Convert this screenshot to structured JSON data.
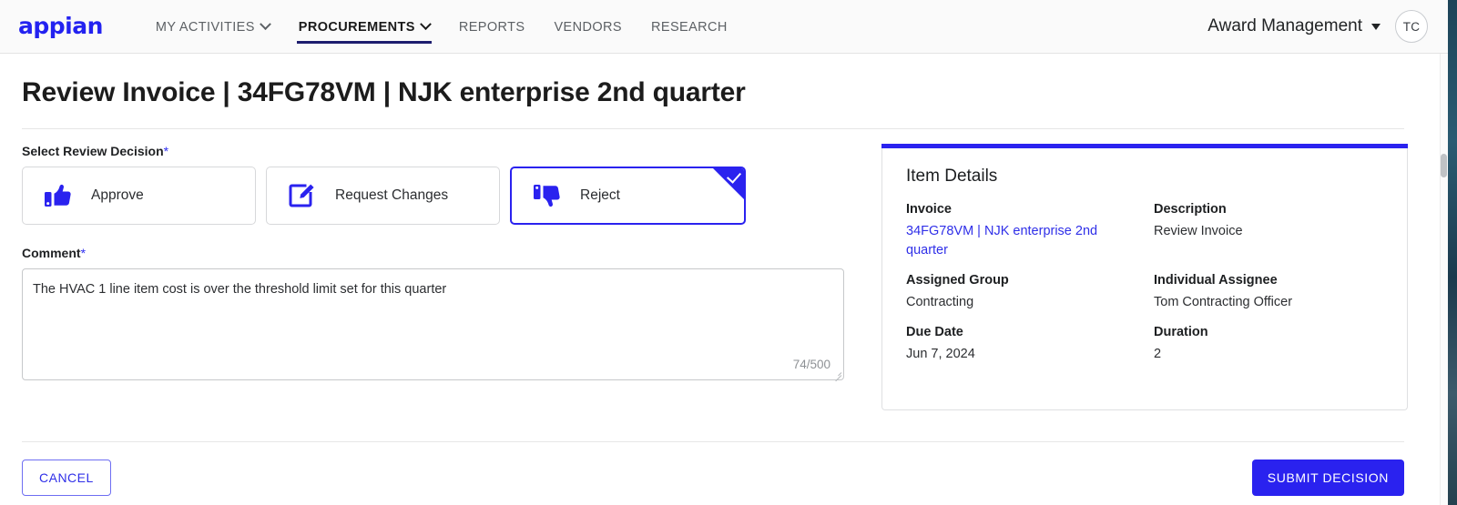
{
  "brand": {
    "logo_text": "appian",
    "logo_color": "#2322f0"
  },
  "nav": {
    "items": [
      {
        "label": "MY ACTIVITIES",
        "has_dropdown": true,
        "active": false
      },
      {
        "label": "PROCUREMENTS",
        "has_dropdown": true,
        "active": true
      },
      {
        "label": "REPORTS",
        "has_dropdown": false,
        "active": false
      },
      {
        "label": "VENDORS",
        "has_dropdown": false,
        "active": false
      },
      {
        "label": "RESEARCH",
        "has_dropdown": false,
        "active": false
      }
    ],
    "site_selector": "Award Management",
    "avatar_initials": "TC"
  },
  "page": {
    "title": "Review Invoice | 34FG78VM | NJK enterprise 2nd quarter"
  },
  "decision": {
    "label": "Select Review Decision",
    "required_marker": "*",
    "options": [
      {
        "label": "Approve",
        "icon": "thumbs-up-icon",
        "selected": false
      },
      {
        "label": "Request Changes",
        "icon": "edit-square-icon",
        "selected": false
      },
      {
        "label": "Reject",
        "icon": "thumbs-down-icon",
        "selected": true
      }
    ]
  },
  "comment": {
    "label": "Comment",
    "required_marker": "*",
    "value": "The HVAC 1 line item cost is over the threshold limit set for this quarter",
    "placeholder": "",
    "counter": "74/500"
  },
  "item_details": {
    "title": "Item Details",
    "fields": [
      {
        "label": "Invoice",
        "value": "34FG78VM | NJK enterprise 2nd quarter",
        "is_link": true
      },
      {
        "label": "Description",
        "value": "Review Invoice",
        "is_link": false
      },
      {
        "label": "Assigned Group",
        "value": "Contracting",
        "is_link": false
      },
      {
        "label": "Individual Assignee",
        "value": "Tom Contracting Officer",
        "is_link": false
      },
      {
        "label": "Due Date",
        "value": "Jun 7, 2024",
        "is_link": false
      },
      {
        "label": "Duration",
        "value": "2",
        "is_link": false
      }
    ]
  },
  "footer": {
    "cancel_label": "CANCEL",
    "submit_label": "SUBMIT DECISION"
  },
  "colors": {
    "accent_blue": "#2a22ef",
    "link_blue": "#2f2fe8",
    "nav_active_underline": "#1d1d6e"
  }
}
